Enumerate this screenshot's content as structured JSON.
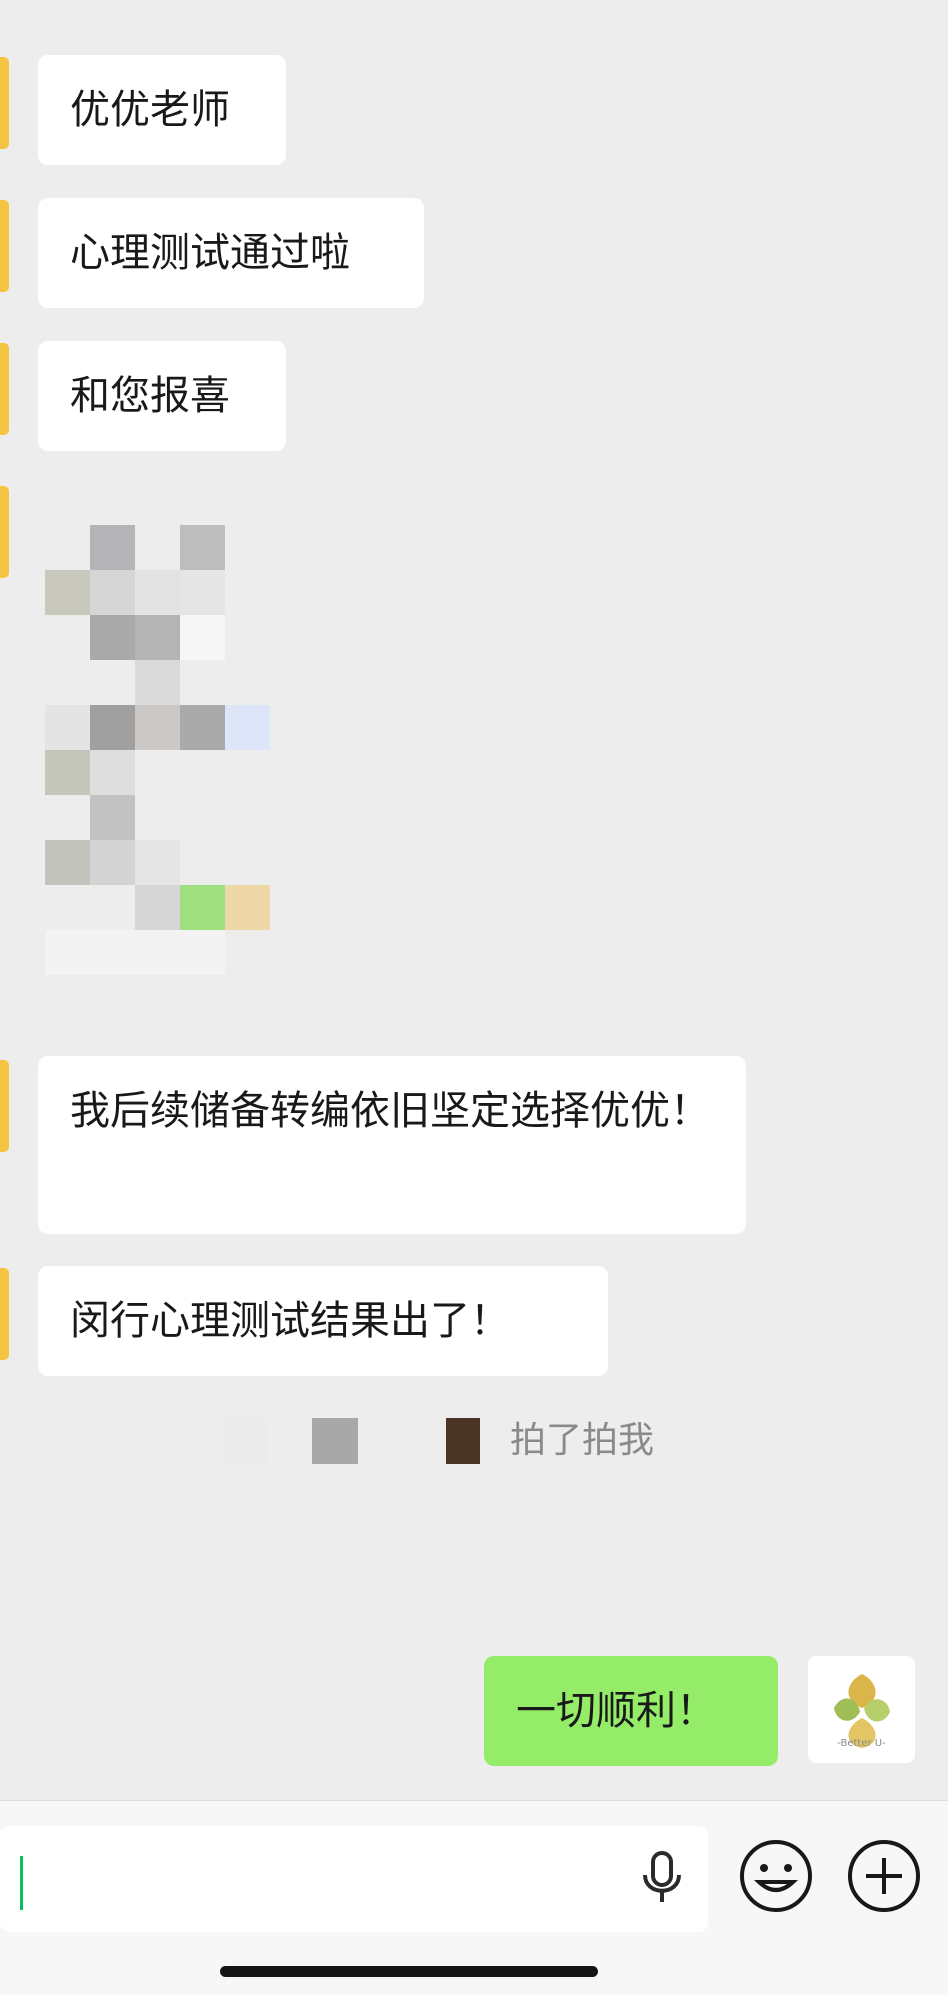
{
  "messages": [
    {
      "text": "优优老师"
    },
    {
      "text": "心理测试通过啦"
    },
    {
      "text": "和您报喜"
    },
    {
      "text": "我后续储备转编依旧坚定选择优优！"
    },
    {
      "text": "闵行心理测试结果出了！"
    },
    {
      "text": "一切顺利！"
    }
  ],
  "pat_text": "拍了拍我",
  "avatar_caption": "-Better U-",
  "colors": {
    "background": "#ededed",
    "incoming": "#ffffff",
    "outgoing": "#95ec69",
    "avatar_accent": "#f5c443",
    "cursor": "#07c160"
  },
  "icons": [
    "mic-icon",
    "emoji-icon",
    "plus-icon"
  ]
}
